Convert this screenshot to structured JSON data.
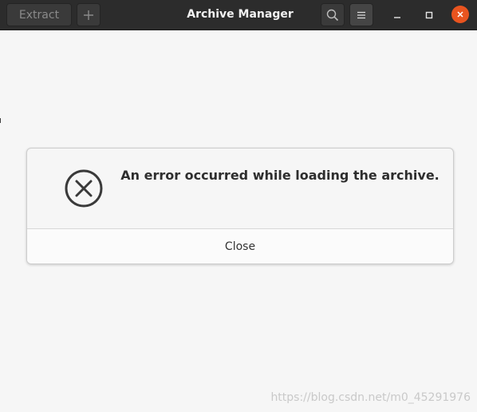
{
  "window": {
    "title": "Archive Manager"
  },
  "headerbar": {
    "extract_label": "Extract",
    "add_icon": "plus-icon",
    "search_icon": "search-icon",
    "menu_icon": "hamburger-menu-icon",
    "minimize_icon": "minimize-icon",
    "maximize_icon": "maximize-icon",
    "close_icon": "close-icon",
    "close_color": "#e9541f"
  },
  "dialog": {
    "icon": "error-circle-x-icon",
    "message": "An error occurred while loading the archive.",
    "close_label": "Close"
  },
  "watermark": "https://blog.csdn.net/m0_45291976"
}
